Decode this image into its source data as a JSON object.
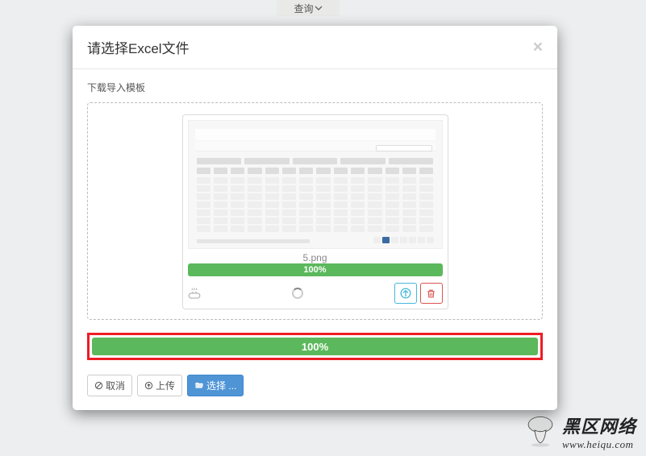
{
  "topbar": {
    "query_label": "查询"
  },
  "modal": {
    "title": "请选择Excel文件",
    "template_link": "下载导入模板",
    "preview": {
      "file_name": "5.png",
      "progress_text": "100%"
    },
    "overall_progress": "100%",
    "buttons": {
      "cancel": "取消",
      "upload": "上传",
      "select": "选择 ..."
    }
  },
  "watermark": {
    "cn": "黑区网络",
    "en": "www.heiqu.com"
  }
}
